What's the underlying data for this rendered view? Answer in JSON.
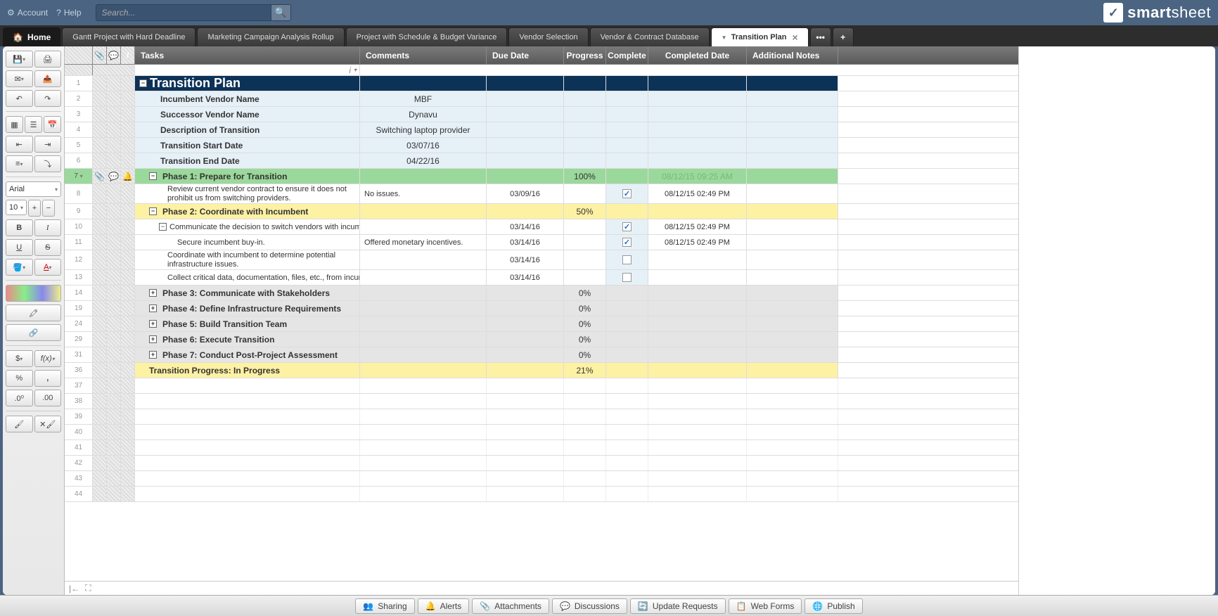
{
  "topbar": {
    "account": "Account",
    "help": "Help",
    "search_placeholder": "Search...",
    "logo": "smartsheet"
  },
  "tabs": {
    "home": "Home",
    "items": [
      "Gantt Project with Hard Deadline",
      "Marketing Campaign Analysis Rollup",
      "Project with Schedule & Budget Variance",
      "Vendor Selection",
      "Vendor & Contract Database"
    ],
    "active": "Transition Plan",
    "more": "•••",
    "add": "+"
  },
  "toolbar": {
    "font": "Arial",
    "font_size": "10",
    "plus": "+",
    "minus": "−",
    "bold": "B",
    "italic": "I",
    "underline": "U",
    "strike": "S",
    "currency": "$",
    "fx": "f(x)",
    "percent": "%",
    "comma": ","
  },
  "columns": {
    "tasks": "Tasks",
    "comments": "Comments",
    "due_date": "Due Date",
    "progress": "Progress",
    "complete": "Complete",
    "completed_date": "Completed Date",
    "notes": "Additional Notes"
  },
  "sheet": {
    "title": "Transition Plan",
    "info": [
      {
        "label": "Incumbent Vendor Name",
        "value": "MBF"
      },
      {
        "label": "Successor Vendor Name",
        "value": "Dynavu"
      },
      {
        "label": "Description of Transition",
        "value": "Switching laptop provider"
      },
      {
        "label": "Transition Start Date",
        "value": "03/07/16"
      },
      {
        "label": "Transition End Date",
        "value": "04/22/16"
      }
    ],
    "phase1": {
      "label": "Phase 1: Prepare for Transition",
      "progress": "100%",
      "compdate": "08/12/15 09:25 AM"
    },
    "task1": {
      "label": "Review current vendor contract to ensure it does not prohibit us from switching providers.",
      "comments": "No issues.",
      "due": "03/09/16",
      "checked": true,
      "compdate": "08/12/15 02:49 PM"
    },
    "phase2": {
      "label": "Phase 2: Coordinate with Incumbent",
      "progress": "50%"
    },
    "task2a": {
      "label": "Communicate the decision to switch vendors with incumbent.",
      "due": "03/14/16",
      "checked": true,
      "compdate": "08/12/15 02:49 PM"
    },
    "task2b": {
      "label": "Secure incumbent buy-in.",
      "comments": "Offered monetary incentives.",
      "due": "03/14/16",
      "checked": true,
      "compdate": "08/12/15 02:49 PM"
    },
    "task2c": {
      "label": "Coordinate with incumbent to determine potential infrastructure issues.",
      "due": "03/14/16",
      "checked": false
    },
    "task2d": {
      "label": "Collect critical data, documentation, files, etc., from incumbent",
      "due": "03/14/16",
      "checked": false
    },
    "phase3": {
      "label": "Phase 3: Communicate with Stakeholders",
      "progress": "0%"
    },
    "phase4": {
      "label": "Phase 4: Define Infrastructure Requirements",
      "progress": "0%"
    },
    "phase5": {
      "label": "Phase 5: Build Transition Team",
      "progress": "0%"
    },
    "phase6": {
      "label": "Phase 6: Execute Transition",
      "progress": "0%"
    },
    "phase7": {
      "label": "Phase 7: Conduct Post-Project Assessment",
      "progress": "0%"
    },
    "summary": {
      "label": "Transition Progress: In Progress",
      "progress": "21%"
    },
    "rownums": [
      "1",
      "2",
      "3",
      "4",
      "5",
      "6",
      "7",
      "8",
      "9",
      "10",
      "11",
      "12",
      "13",
      "14",
      "19",
      "24",
      "29",
      "31",
      "36",
      "37",
      "38",
      "39",
      "40",
      "41",
      "42",
      "43",
      "44"
    ]
  },
  "bottombar": {
    "sharing": "Sharing",
    "alerts": "Alerts",
    "attachments": "Attachments",
    "discussions": "Discussions",
    "update": "Update Requests",
    "forms": "Web Forms",
    "publish": "Publish"
  }
}
